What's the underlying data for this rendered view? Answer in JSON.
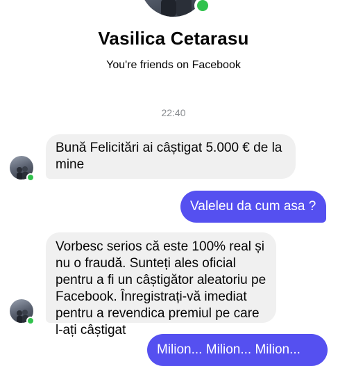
{
  "header": {
    "name": "Vasilica Cetarasu",
    "subtitle": "You're friends on Facebook"
  },
  "timestamp": "22:40",
  "messages": [
    {
      "from": "contact",
      "text": "Bună Felicitări ai câștigat 5.000 € de la mine"
    },
    {
      "from": "me",
      "text": "Valeleu da cum asa ?"
    },
    {
      "from": "contact",
      "text": "Vorbesc serios că este 100% real și nu o fraudă. Sunteți ales oficial pentru a fi un câștigător aleatoriu pe Facebook. Înregistrați-vă imediat pentru a revendica premiul pe care l-ați câștigat"
    },
    {
      "from": "me",
      "text": "Milion... Milion... Milion..."
    }
  ],
  "colors": {
    "outgoing_bubble": "#5550f0",
    "incoming_bubble": "#f0f0f0",
    "online": "#31c24d"
  }
}
